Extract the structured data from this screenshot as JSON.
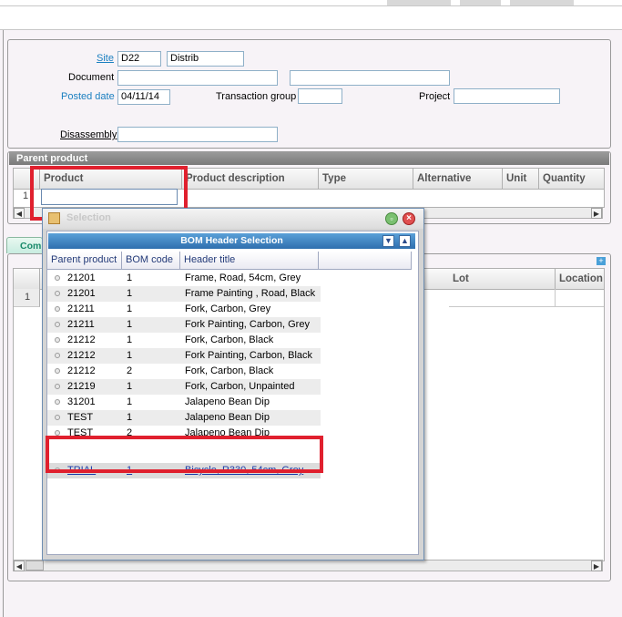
{
  "form": {
    "site_label": "Site",
    "site_value": "D22",
    "site_name": "Distrib",
    "document_label": "Document",
    "posted_date_label": "Posted date",
    "posted_date_value": "04/11/14",
    "transaction_group_label": "Transaction group",
    "project_label": "Project",
    "disassembly_label": "Disassembly"
  },
  "parent_product": {
    "section_title": "Parent product",
    "columns": [
      "Product",
      "Product description",
      "Type",
      "Alternative",
      "Unit",
      "Quantity"
    ],
    "row_number": "1"
  },
  "components": {
    "tab_label": "Comp",
    "columns": [
      "Lot",
      "Location"
    ],
    "row_number": "1"
  },
  "selection_popup": {
    "title": "Selection",
    "header": "BOM Header Selection",
    "columns": [
      "Parent product",
      "BOM code",
      "Header title"
    ],
    "rows": [
      {
        "product": "21201",
        "bom": "1",
        "title": "Frame, Road, 54cm, Grey"
      },
      {
        "product": "21201",
        "bom": "1",
        "title": "Frame Painting , Road,  Black"
      },
      {
        "product": "21211",
        "bom": "1",
        "title": "Fork, Carbon, Grey"
      },
      {
        "product": "21211",
        "bom": "1",
        "title": "Fork Painting, Carbon, Grey"
      },
      {
        "product": "21212",
        "bom": "1",
        "title": "Fork, Carbon, Black"
      },
      {
        "product": "21212",
        "bom": "1",
        "title": "Fork Painting, Carbon, Black"
      },
      {
        "product": "21212",
        "bom": "2",
        "title": "Fork, Carbon, Black"
      },
      {
        "product": "21219",
        "bom": "1",
        "title": "Fork, Carbon, Unpainted"
      },
      {
        "product": "31201",
        "bom": "1",
        "title": "Jalapeno Bean Dip"
      },
      {
        "product": "TEST",
        "bom": "1",
        "title": "Jalapeno Bean Dip"
      },
      {
        "product": "TEST",
        "bom": "2",
        "title": "Jalapeno Bean Dip"
      }
    ],
    "selected_row": {
      "product": "TRIAL",
      "bom": "1",
      "title": "Bicycle, R330, 54cm, Grey"
    }
  },
  "colors": {
    "highlight": "#e0202e",
    "link": "#1a7fc0",
    "popup_header": "#2f6fae"
  }
}
